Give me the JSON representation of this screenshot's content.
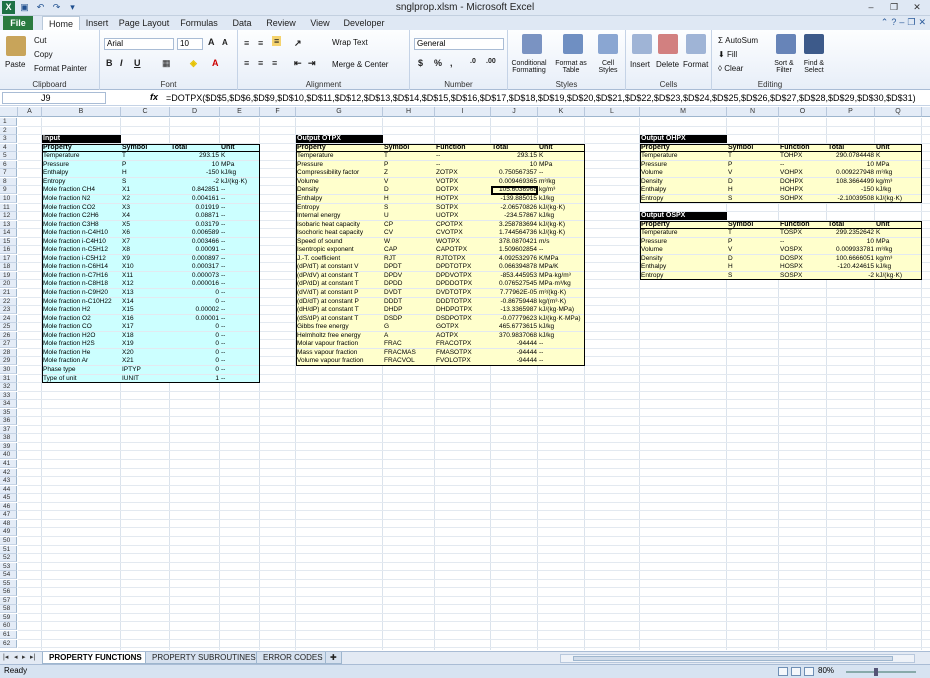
{
  "window": {
    "title": "snglprop.xlsm - Microsoft Excel"
  },
  "qat": {
    "icons": [
      "excel-logo",
      "save-icon",
      "undo-icon",
      "redo-icon"
    ]
  },
  "ribbon_tabs": [
    "File",
    "Home",
    "Insert",
    "Page Layout",
    "Formulas",
    "Data",
    "Review",
    "View",
    "Developer"
  ],
  "active_tab": "Home",
  "ribbon": {
    "clipboard": {
      "label": "Clipboard",
      "paste": "Paste",
      "cut": "Cut",
      "copy": "Copy",
      "format_painter": "Format Painter"
    },
    "font": {
      "label": "Font",
      "name": "Arial",
      "size": "10"
    },
    "alignment": {
      "label": "Alignment",
      "wrap": "Wrap Text",
      "merge": "Merge & Center"
    },
    "number": {
      "label": "Number",
      "format": "General"
    },
    "styles": {
      "label": "Styles",
      "cond": "Conditional Formatting",
      "table": "Format as Table",
      "cell": "Cell Styles"
    },
    "cells": {
      "label": "Cells",
      "insert": "Insert",
      "delete": "Delete",
      "format": "Format"
    },
    "editing": {
      "label": "Editing",
      "autosum": "AutoSum",
      "fill": "Fill",
      "clear": "Clear",
      "sort": "Sort & Filter",
      "find": "Find & Select"
    }
  },
  "formula_bar": {
    "name_box": "J9",
    "fx": "fx",
    "formula": "=DOTPX($D$5,$D$6,$D$9,$D$10,$D$11,$D$12,$D$13,$D$14,$D$15,$D$16,$D$17,$D$18,$D$19,$D$20,$D$21,$D$22,$D$23,$D$24,$D$25,$D$26,$D$27,$D$28,$D$29,$D$30,$D$31)"
  },
  "columns": [
    "A",
    "B",
    "C",
    "D",
    "E",
    "F",
    "G",
    "H",
    "I",
    "J",
    "K",
    "L",
    "M",
    "N",
    "O",
    "P",
    "Q",
    "R"
  ],
  "input_table": {
    "title": "Input",
    "headers": [
      "Property",
      "Symbol",
      "Total",
      "Unit"
    ],
    "rows": [
      [
        "Temperature",
        "T",
        "293.15",
        "K"
      ],
      [
        "Pressure",
        "P",
        "10",
        "MPa"
      ],
      [
        "Enthalpy",
        "H",
        "-150",
        "kJ/kg"
      ],
      [
        "Entropy",
        "S",
        "-2",
        "kJ/(kg·K)"
      ],
      [
        "Mole fraction CH4",
        "X1",
        "0.842851",
        "--"
      ],
      [
        "Mole fraction N2",
        "X2",
        "0.004161",
        "--"
      ],
      [
        "Mole fraction CO2",
        "X3",
        "0.01919",
        "--"
      ],
      [
        "Mole fraction C2H6",
        "X4",
        "0.08871",
        "--"
      ],
      [
        "Mole fraction C3H8",
        "X5",
        "0.03179",
        "--"
      ],
      [
        "Mole fraction n-C4H10",
        "X6",
        "0.006589",
        "--"
      ],
      [
        "Mole fraction i-C4H10",
        "X7",
        "0.003466",
        "--"
      ],
      [
        "Mole fraction n-C5H12",
        "X8",
        "0.00091",
        "--"
      ],
      [
        "Mole fraction i-C5H12",
        "X9",
        "0.000897",
        "--"
      ],
      [
        "Mole fraction n-C6H14",
        "X10",
        "0.000317",
        "--"
      ],
      [
        "Mole fraction n-C7H16",
        "X11",
        "0.000073",
        "--"
      ],
      [
        "Mole fraction n-C8H18",
        "X12",
        "0.000016",
        "--"
      ],
      [
        "Mole fraction n-C9H20",
        "X13",
        "0",
        "--"
      ],
      [
        "Mole fraction n-C10H22",
        "X14",
        "0",
        "--"
      ],
      [
        "Mole fraction H2",
        "X15",
        "0.00002",
        "--"
      ],
      [
        "Mole fraction O2",
        "X16",
        "0.00001",
        "--"
      ],
      [
        "Mole fraction CO",
        "X17",
        "0",
        "--"
      ],
      [
        "Mole fraction H2O",
        "X18",
        "0",
        "--"
      ],
      [
        "Mole fraction H2S",
        "X19",
        "0",
        "--"
      ],
      [
        "Mole fraction He",
        "X20",
        "0",
        "--"
      ],
      [
        "Mole fraction Ar",
        "X21",
        "0",
        "--"
      ],
      [
        "Phase type",
        "IPTYP",
        "0",
        "--"
      ],
      [
        "Type of unit",
        "IUNIT",
        "1",
        "--"
      ]
    ]
  },
  "otpx_table": {
    "title": "Output OTPX",
    "headers": [
      "Property",
      "Symbol",
      "Function",
      "Total",
      "Unit"
    ],
    "rows": [
      [
        "Temperature",
        "T",
        "--",
        "293.15",
        "K"
      ],
      [
        "Pressure",
        "P",
        "--",
        "10",
        "MPa"
      ],
      [
        "Compressibility factor",
        "Z",
        "ZOTPX",
        "0.750567357",
        "--"
      ],
      [
        "Volume",
        "V",
        "VOTPX",
        "0.009469365",
        "m³/kg"
      ],
      [
        "Density",
        "D",
        "DOTPX",
        "105.6036968",
        "kg/m³"
      ],
      [
        "Enthalpy",
        "H",
        "HOTPX",
        "-139.885015",
        "kJ/kg"
      ],
      [
        "Entropy",
        "S",
        "SOTPX",
        "-2.06570826",
        "kJ/(kg·K)"
      ],
      [
        "Internal energy",
        "U",
        "UOTPX",
        "-234.57867",
        "kJ/kg"
      ],
      [
        "Isobaric heat capacity",
        "CP",
        "CPOTPX",
        "3.258783694",
        "kJ/(kg·K)"
      ],
      [
        "Isochoric heat capacity",
        "CV",
        "CVOTPX",
        "1.744564736",
        "kJ/(kg·K)"
      ],
      [
        "Speed of sound",
        "W",
        "WOTPX",
        "378.0870421",
        "m/s"
      ],
      [
        "Isentropic exponent",
        "CAP",
        "CAPOTPX",
        "1.509602854",
        "--"
      ],
      [
        "J.-T. coefficient",
        "RJT",
        "RJTOTPX",
        "4.092532976",
        "K/MPa"
      ],
      [
        "(dP/dT) at constant V",
        "DPDT",
        "DPDTOTPX",
        "0.066394878",
        "MPa/K"
      ],
      [
        "(dP/dV) at constant T",
        "DPDV",
        "DPDVOTPX",
        "-853.445953",
        "MPa·kg/m³"
      ],
      [
        "(dP/dD) at constant T",
        "DPDD",
        "DPDDOTPX",
        "0.076527545",
        "MPa·m³/kg"
      ],
      [
        "(dV/dT) at constant P",
        "DVDT",
        "DVDTOTPX",
        "7.77962E-05",
        "m³/(kg·K)"
      ],
      [
        "(dD/dT) at constant P",
        "DDDT",
        "DDDTOTPX",
        "-0.86759448",
        "kg/(m³·K)"
      ],
      [
        "(dH/dP) at constant T",
        "DHDP",
        "DHDPOTPX",
        "-13.3365987",
        "kJ/(kg·MPa)"
      ],
      [
        "(dS/dP) at constant T",
        "DSDP",
        "DSDPOTPX",
        "-0.07779623",
        "kJ/(kg·K·MPa)"
      ],
      [
        "Gibbs free energy",
        "G",
        "GOTPX",
        "465.6773615",
        "kJ/kg"
      ],
      [
        "Helmholtz free energy",
        "A",
        "AOTPX",
        "370.9837068",
        "kJ/kg"
      ],
      [
        "Molar vapour fraction",
        "FRAC",
        "FRACOTPX",
        "-94444",
        "--"
      ],
      [
        "Mass vapour fraction",
        "FRACMAS",
        "FMASOTPX",
        "-94444",
        "--"
      ],
      [
        "Volume vapour fraction",
        "FRACVOL",
        "FVOLOTPX",
        "-94444",
        "--"
      ]
    ]
  },
  "ohpx_table": {
    "title": "Output OHPX",
    "headers": [
      "Property",
      "Symbol",
      "Function",
      "Total",
      "Unit"
    ],
    "rows": [
      [
        "Temperature",
        "T",
        "TOHPX",
        "290.0784448",
        "K"
      ],
      [
        "Pressure",
        "P",
        "--",
        "10",
        "MPa"
      ],
      [
        "Volume",
        "V",
        "VOHPX",
        "0.009227948",
        "m³/kg"
      ],
      [
        "Density",
        "D",
        "DOHPX",
        "108.3664499",
        "kg/m³"
      ],
      [
        "Enthalpy",
        "H",
        "HOHPX",
        "-150",
        "kJ/kg"
      ],
      [
        "Entropy",
        "S",
        "SOHPX",
        "-2.10039508",
        "kJ/(kg·K)"
      ]
    ]
  },
  "ospx_table": {
    "title": "Output OSPX",
    "headers": [
      "Property",
      "Symbol",
      "Function",
      "Total",
      "Unit"
    ],
    "rows": [
      [
        "Temperature",
        "T",
        "TOSPX",
        "299.2352642",
        "K"
      ],
      [
        "Pressure",
        "P",
        "--",
        "10",
        "MPa"
      ],
      [
        "Volume",
        "V",
        "VOSPX",
        "0.009933781",
        "m³/kg"
      ],
      [
        "Density",
        "D",
        "DOSPX",
        "100.6666051",
        "kg/m³"
      ],
      [
        "Enthalpy",
        "H",
        "HOSPX",
        "-120.424615",
        "kJ/kg"
      ],
      [
        "Entropy",
        "S",
        "SOSPX",
        "-2",
        "kJ/(kg·K)"
      ]
    ]
  },
  "sheet_tabs": [
    "PROPERTY FUNCTIONS",
    "PROPERTY SUBROUTINES",
    "ERROR CODES"
  ],
  "active_sheet": "PROPERTY FUNCTIONS",
  "status": {
    "mode": "Ready",
    "zoom": "80%"
  }
}
